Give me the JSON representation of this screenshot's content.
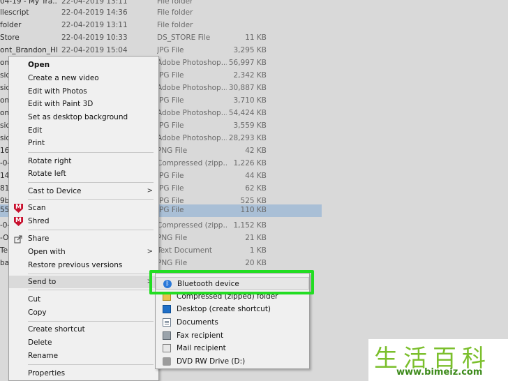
{
  "files": [
    {
      "name": "04-19 - My Tra...",
      "date": "22-04-2019 13:11",
      "type": "File folder",
      "size": ""
    },
    {
      "name": "llescript",
      "date": "22-04-2019 14:36",
      "type": "File folder",
      "size": ""
    },
    {
      "name": "folder",
      "date": "22-04-2019 13:11",
      "type": "File folder",
      "size": ""
    },
    {
      "name": "Store",
      "date": "22-04-2019 10:33",
      "type": "DS_STORE File",
      "size": "11 KB"
    },
    {
      "name": "ont_Brandon_HB",
      "date": "22-04-2019 15:04",
      "type": "JPG File",
      "size": "3,295 KB"
    },
    {
      "name": "on",
      "date": "",
      "type": "Adobe Photoshop...",
      "size": "56,997 KB"
    },
    {
      "name": "sid",
      "date": "",
      "type": "JPG File",
      "size": "2,342 KB"
    },
    {
      "name": "sid",
      "date": "",
      "type": "Adobe Photoshop...",
      "size": "30,887 KB"
    },
    {
      "name": "on",
      "date": "",
      "type": "JPG File",
      "size": "3,710 KB"
    },
    {
      "name": "on",
      "date": "",
      "type": "Adobe Photoshop...",
      "size": "54,424 KB"
    },
    {
      "name": "sid",
      "date": "",
      "type": "JPG File",
      "size": "3,559 KB"
    },
    {
      "name": "sid",
      "date": "",
      "type": "Adobe Photoshop...",
      "size": "28,293 KB"
    },
    {
      "name": "16",
      "date": "",
      "type": "PNG File",
      "size": "42 KB"
    },
    {
      "name": "-04",
      "date": "",
      "type": "Compressed (zipp...",
      "size": "1,226 KB"
    },
    {
      "name": "14",
      "date": "",
      "type": "JPG File",
      "size": "44 KB"
    },
    {
      "name": "81",
      "date": "",
      "type": "JPG File",
      "size": "62 KB"
    },
    {
      "name": "9b",
      "date": "",
      "type": "JPG File",
      "size": "525 KB"
    },
    {
      "name": "55",
      "date": "",
      "type": "JPG File",
      "size": "110 KB"
    },
    {
      "name": "-04",
      "date": "",
      "type": "Compressed (zipp...",
      "size": "1,152 KB"
    },
    {
      "name": "-O",
      "date": "",
      "type": "PNG File",
      "size": "21 KB"
    },
    {
      "name": "Te",
      "date": "",
      "type": "Text Document",
      "size": "1 KB"
    },
    {
      "name": "ba",
      "date": "",
      "type": "PNG File",
      "size": "20 KB"
    }
  ],
  "context_menu": {
    "open": "Open",
    "create_video": "Create a new video",
    "edit_photos": "Edit with Photos",
    "edit_paint3d": "Edit with Paint 3D",
    "set_desktop": "Set as desktop background",
    "edit": "Edit",
    "print": "Print",
    "rotate_right": "Rotate right",
    "rotate_left": "Rotate left",
    "cast": "Cast to Device",
    "scan": "Scan",
    "shred": "Shred",
    "share": "Share",
    "open_with": "Open with",
    "restore": "Restore previous versions",
    "send_to": "Send to",
    "cut": "Cut",
    "copy": "Copy",
    "create_shortcut": "Create shortcut",
    "delete": "Delete",
    "rename": "Rename",
    "properties": "Properties",
    "arrow": ">"
  },
  "send_to_menu": {
    "bluetooth": "Bluetooth device",
    "compressed": "Compressed (zipped) folder",
    "desktop": "Desktop (create shortcut)",
    "documents": "Documents",
    "fax": "Fax recipient",
    "mail": "Mail recipient",
    "dvd": "DVD RW Drive (D:)"
  },
  "watermark": {
    "title": "生活百科",
    "url": "www.bimeiz.com"
  },
  "colors": {
    "selection": "#a9bfd6",
    "highlight_box": "#22dd22",
    "menu_bg": "#f0f0f0"
  }
}
